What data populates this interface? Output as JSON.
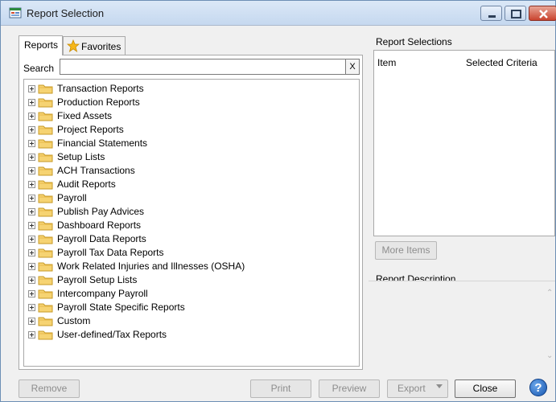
{
  "window": {
    "title": "Report Selection"
  },
  "tabs": [
    {
      "label": "Reports"
    },
    {
      "label": "Favorites"
    }
  ],
  "search": {
    "label": "Search",
    "value": "",
    "clear_label": "X"
  },
  "tree": {
    "items": [
      "Transaction Reports",
      "Production Reports",
      "Fixed Assets",
      "Project Reports",
      "Financial Statements",
      "Setup Lists",
      "ACH Transactions",
      "Audit Reports",
      "Payroll",
      "Publish Pay Advices",
      "Dashboard Reports",
      "Payroll Data Reports",
      "Payroll Tax Data Reports",
      "Work Related Injuries and Illnesses (OSHA)",
      "Payroll Setup Lists",
      "Intercompany Payroll",
      "Payroll State Specific Reports",
      "Custom",
      "User-defined/Tax Reports"
    ]
  },
  "report_selections": {
    "title": "Report Selections",
    "columns": [
      "Item",
      "Selected Criteria"
    ],
    "more_items_label": "More Items"
  },
  "report_description": {
    "title": "Report Description"
  },
  "buttons": {
    "remove": "Remove",
    "print": "Print",
    "preview": "Preview",
    "export": "Export",
    "close": "Close",
    "help": "?"
  },
  "colors": {
    "titlebar": "#c5d8ef",
    "folder": "#f2c94c",
    "help": "#1857b0"
  }
}
